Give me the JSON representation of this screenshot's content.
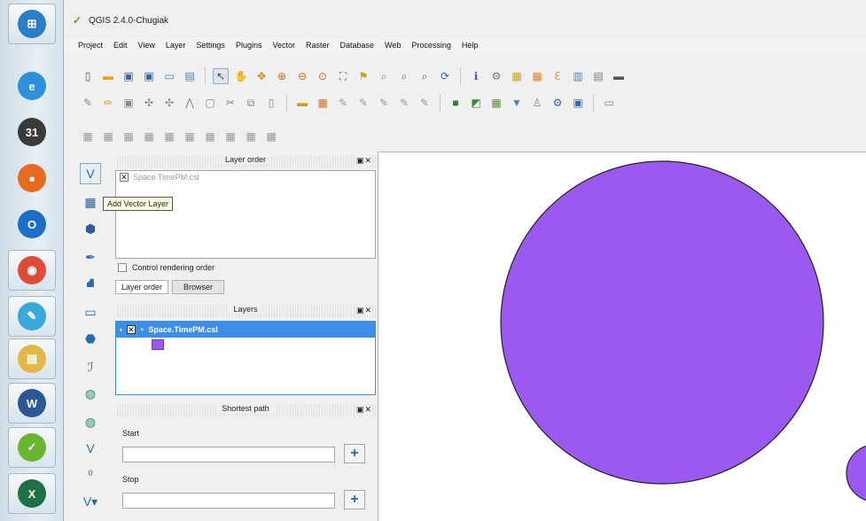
{
  "window": {
    "title": "QGIS 2.4.0-Chugiak"
  },
  "menu": [
    "Project",
    "Edit",
    "View",
    "Layer",
    "Settings",
    "Plugins",
    "Vector",
    "Raster",
    "Database",
    "Web",
    "Processing",
    "Help"
  ],
  "taskbar": [
    {
      "name": "start-orb-icon",
      "color": "#2a7fc7",
      "glyph": "⊞"
    },
    {
      "name": "internet-explorer-icon",
      "color": "#2f8fd8",
      "glyph": "e"
    },
    {
      "name": "calendar-icon",
      "color": "#3a3a3a",
      "glyph": "31"
    },
    {
      "name": "firefox-icon",
      "color": "#e66a1f",
      "glyph": "●"
    },
    {
      "name": "outlook-icon",
      "color": "#1d6fc4",
      "glyph": "O"
    },
    {
      "name": "chrome-icon",
      "color": "#dd4b39",
      "glyph": "◉"
    },
    {
      "name": "paint-icon",
      "color": "#3aa8d8",
      "glyph": "✎"
    },
    {
      "name": "file-explorer-icon",
      "color": "#e3b84a",
      "glyph": "▤"
    },
    {
      "name": "word-icon",
      "color": "#2b5797",
      "glyph": "W"
    },
    {
      "name": "qgis-icon",
      "color": "#6ab42f",
      "glyph": "✓"
    },
    {
      "name": "excel-icon",
      "color": "#1e7145",
      "glyph": "X"
    }
  ],
  "tooltip": "Add Vector Layer",
  "layer_order_panel": {
    "title": "Layer order",
    "items": [
      "Space.TimePM.csl"
    ],
    "control_rendering_label": "Control rendering order",
    "tabs": [
      "Layer order",
      "Browser"
    ]
  },
  "layers_panel": {
    "title": "Layers",
    "layer_name": "Space.TimePM.csl",
    "symbol_color": "#9b59f0"
  },
  "shortest_path_panel": {
    "title": "Shortest path",
    "start_label": "Start",
    "stop_label": "Stop",
    "start_value": "",
    "stop_value": ""
  },
  "map": {
    "fill_color": "#9b59f0"
  }
}
